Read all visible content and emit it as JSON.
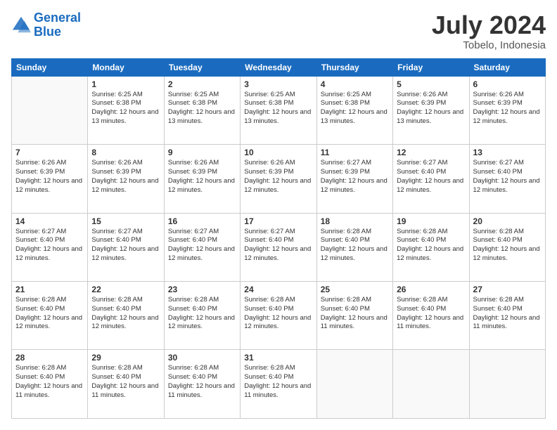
{
  "header": {
    "logo_line1": "General",
    "logo_line2": "Blue",
    "month_year": "July 2024",
    "location": "Tobelo, Indonesia"
  },
  "weekdays": [
    "Sunday",
    "Monday",
    "Tuesday",
    "Wednesday",
    "Thursday",
    "Friday",
    "Saturday"
  ],
  "weeks": [
    [
      {
        "day": "",
        "sunrise": "",
        "sunset": "",
        "daylight": ""
      },
      {
        "day": "1",
        "sunrise": "Sunrise: 6:25 AM",
        "sunset": "Sunset: 6:38 PM",
        "daylight": "Daylight: 12 hours and 13 minutes."
      },
      {
        "day": "2",
        "sunrise": "Sunrise: 6:25 AM",
        "sunset": "Sunset: 6:38 PM",
        "daylight": "Daylight: 12 hours and 13 minutes."
      },
      {
        "day": "3",
        "sunrise": "Sunrise: 6:25 AM",
        "sunset": "Sunset: 6:38 PM",
        "daylight": "Daylight: 12 hours and 13 minutes."
      },
      {
        "day": "4",
        "sunrise": "Sunrise: 6:25 AM",
        "sunset": "Sunset: 6:38 PM",
        "daylight": "Daylight: 12 hours and 13 minutes."
      },
      {
        "day": "5",
        "sunrise": "Sunrise: 6:26 AM",
        "sunset": "Sunset: 6:39 PM",
        "daylight": "Daylight: 12 hours and 13 minutes."
      },
      {
        "day": "6",
        "sunrise": "Sunrise: 6:26 AM",
        "sunset": "Sunset: 6:39 PM",
        "daylight": "Daylight: 12 hours and 12 minutes."
      }
    ],
    [
      {
        "day": "7",
        "sunrise": "Sunrise: 6:26 AM",
        "sunset": "Sunset: 6:39 PM",
        "daylight": "Daylight: 12 hours and 12 minutes."
      },
      {
        "day": "8",
        "sunrise": "Sunrise: 6:26 AM",
        "sunset": "Sunset: 6:39 PM",
        "daylight": "Daylight: 12 hours and 12 minutes."
      },
      {
        "day": "9",
        "sunrise": "Sunrise: 6:26 AM",
        "sunset": "Sunset: 6:39 PM",
        "daylight": "Daylight: 12 hours and 12 minutes."
      },
      {
        "day": "10",
        "sunrise": "Sunrise: 6:26 AM",
        "sunset": "Sunset: 6:39 PM",
        "daylight": "Daylight: 12 hours and 12 minutes."
      },
      {
        "day": "11",
        "sunrise": "Sunrise: 6:27 AM",
        "sunset": "Sunset: 6:39 PM",
        "daylight": "Daylight: 12 hours and 12 minutes."
      },
      {
        "day": "12",
        "sunrise": "Sunrise: 6:27 AM",
        "sunset": "Sunset: 6:40 PM",
        "daylight": "Daylight: 12 hours and 12 minutes."
      },
      {
        "day": "13",
        "sunrise": "Sunrise: 6:27 AM",
        "sunset": "Sunset: 6:40 PM",
        "daylight": "Daylight: 12 hours and 12 minutes."
      }
    ],
    [
      {
        "day": "14",
        "sunrise": "Sunrise: 6:27 AM",
        "sunset": "Sunset: 6:40 PM",
        "daylight": "Daylight: 12 hours and 12 minutes."
      },
      {
        "day": "15",
        "sunrise": "Sunrise: 6:27 AM",
        "sunset": "Sunset: 6:40 PM",
        "daylight": "Daylight: 12 hours and 12 minutes."
      },
      {
        "day": "16",
        "sunrise": "Sunrise: 6:27 AM",
        "sunset": "Sunset: 6:40 PM",
        "daylight": "Daylight: 12 hours and 12 minutes."
      },
      {
        "day": "17",
        "sunrise": "Sunrise: 6:27 AM",
        "sunset": "Sunset: 6:40 PM",
        "daylight": "Daylight: 12 hours and 12 minutes."
      },
      {
        "day": "18",
        "sunrise": "Sunrise: 6:28 AM",
        "sunset": "Sunset: 6:40 PM",
        "daylight": "Daylight: 12 hours and 12 minutes."
      },
      {
        "day": "19",
        "sunrise": "Sunrise: 6:28 AM",
        "sunset": "Sunset: 6:40 PM",
        "daylight": "Daylight: 12 hours and 12 minutes."
      },
      {
        "day": "20",
        "sunrise": "Sunrise: 6:28 AM",
        "sunset": "Sunset: 6:40 PM",
        "daylight": "Daylight: 12 hours and 12 minutes."
      }
    ],
    [
      {
        "day": "21",
        "sunrise": "Sunrise: 6:28 AM",
        "sunset": "Sunset: 6:40 PM",
        "daylight": "Daylight: 12 hours and 12 minutes."
      },
      {
        "day": "22",
        "sunrise": "Sunrise: 6:28 AM",
        "sunset": "Sunset: 6:40 PM",
        "daylight": "Daylight: 12 hours and 12 minutes."
      },
      {
        "day": "23",
        "sunrise": "Sunrise: 6:28 AM",
        "sunset": "Sunset: 6:40 PM",
        "daylight": "Daylight: 12 hours and 12 minutes."
      },
      {
        "day": "24",
        "sunrise": "Sunrise: 6:28 AM",
        "sunset": "Sunset: 6:40 PM",
        "daylight": "Daylight: 12 hours and 12 minutes."
      },
      {
        "day": "25",
        "sunrise": "Sunrise: 6:28 AM",
        "sunset": "Sunset: 6:40 PM",
        "daylight": "Daylight: 12 hours and 11 minutes."
      },
      {
        "day": "26",
        "sunrise": "Sunrise: 6:28 AM",
        "sunset": "Sunset: 6:40 PM",
        "daylight": "Daylight: 12 hours and 11 minutes."
      },
      {
        "day": "27",
        "sunrise": "Sunrise: 6:28 AM",
        "sunset": "Sunset: 6:40 PM",
        "daylight": "Daylight: 12 hours and 11 minutes."
      }
    ],
    [
      {
        "day": "28",
        "sunrise": "Sunrise: 6:28 AM",
        "sunset": "Sunset: 6:40 PM",
        "daylight": "Daylight: 12 hours and 11 minutes."
      },
      {
        "day": "29",
        "sunrise": "Sunrise: 6:28 AM",
        "sunset": "Sunset: 6:40 PM",
        "daylight": "Daylight: 12 hours and 11 minutes."
      },
      {
        "day": "30",
        "sunrise": "Sunrise: 6:28 AM",
        "sunset": "Sunset: 6:40 PM",
        "daylight": "Daylight: 12 hours and 11 minutes."
      },
      {
        "day": "31",
        "sunrise": "Sunrise: 6:28 AM",
        "sunset": "Sunset: 6:40 PM",
        "daylight": "Daylight: 12 hours and 11 minutes."
      },
      {
        "day": "",
        "sunrise": "",
        "sunset": "",
        "daylight": ""
      },
      {
        "day": "",
        "sunrise": "",
        "sunset": "",
        "daylight": ""
      },
      {
        "day": "",
        "sunrise": "",
        "sunset": "",
        "daylight": ""
      }
    ]
  ]
}
